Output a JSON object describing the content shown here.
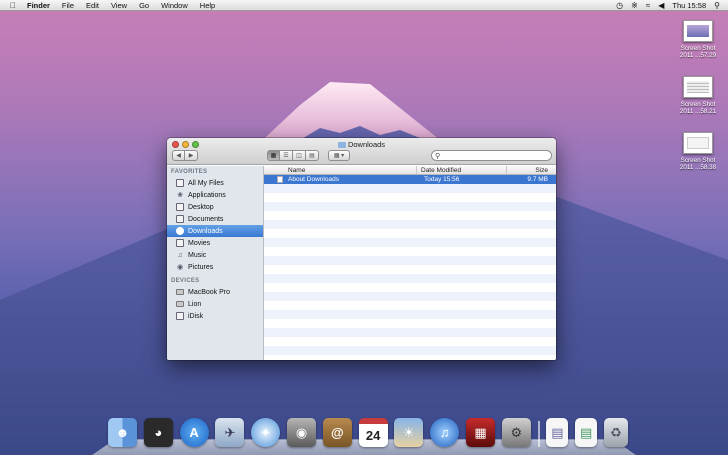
{
  "menubar": {
    "apple_icon": "apple-icon",
    "menus": [
      "Finder",
      "File",
      "Edit",
      "View",
      "Go",
      "Window",
      "Help"
    ],
    "status_icons": [
      "time-machine-icon",
      "bluetooth-icon",
      "wifi-icon",
      "volume-icon"
    ],
    "clock": "Thu 15:58",
    "spotlight_icon": "spotlight-icon"
  },
  "desktop": {
    "icons": [
      {
        "line1": "Screen Shot",
        "line2": "2011 ...57.29"
      },
      {
        "line1": "Screen Shot",
        "line2": "2011 ...58.21"
      },
      {
        "line1": "Screen Shot",
        "line2": "2011 ...58.38"
      }
    ]
  },
  "window": {
    "title": "Downloads",
    "search_placeholder": "",
    "sidebar": {
      "favorites_header": "FAVORITES",
      "favorites": [
        "All My Files",
        "Applications",
        "Desktop",
        "Documents",
        "Downloads",
        "Movies",
        "Music",
        "Pictures"
      ],
      "devices_header": "DEVICES",
      "devices": [
        "MacBook Pro",
        "Lion",
        "iDisk"
      ]
    },
    "columns": {
      "name": "Name",
      "date": "Date Modified",
      "size": "Size"
    },
    "files": [
      {
        "name": "About Downloads",
        "date": "Today 15:56",
        "size": "9.7 MB"
      }
    ]
  },
  "dock": {
    "apps": [
      "finder",
      "dashboard",
      "app-store",
      "mail",
      "safari",
      "facetime",
      "address-book",
      "ical",
      "iphoto",
      "itunes",
      "photo-booth",
      "system-preferences"
    ],
    "ical_day": "24",
    "right": [
      "document",
      "document",
      "trash"
    ]
  },
  "colors": {
    "accent": "#3b76d1",
    "sidebar": "#e1e6ec"
  }
}
